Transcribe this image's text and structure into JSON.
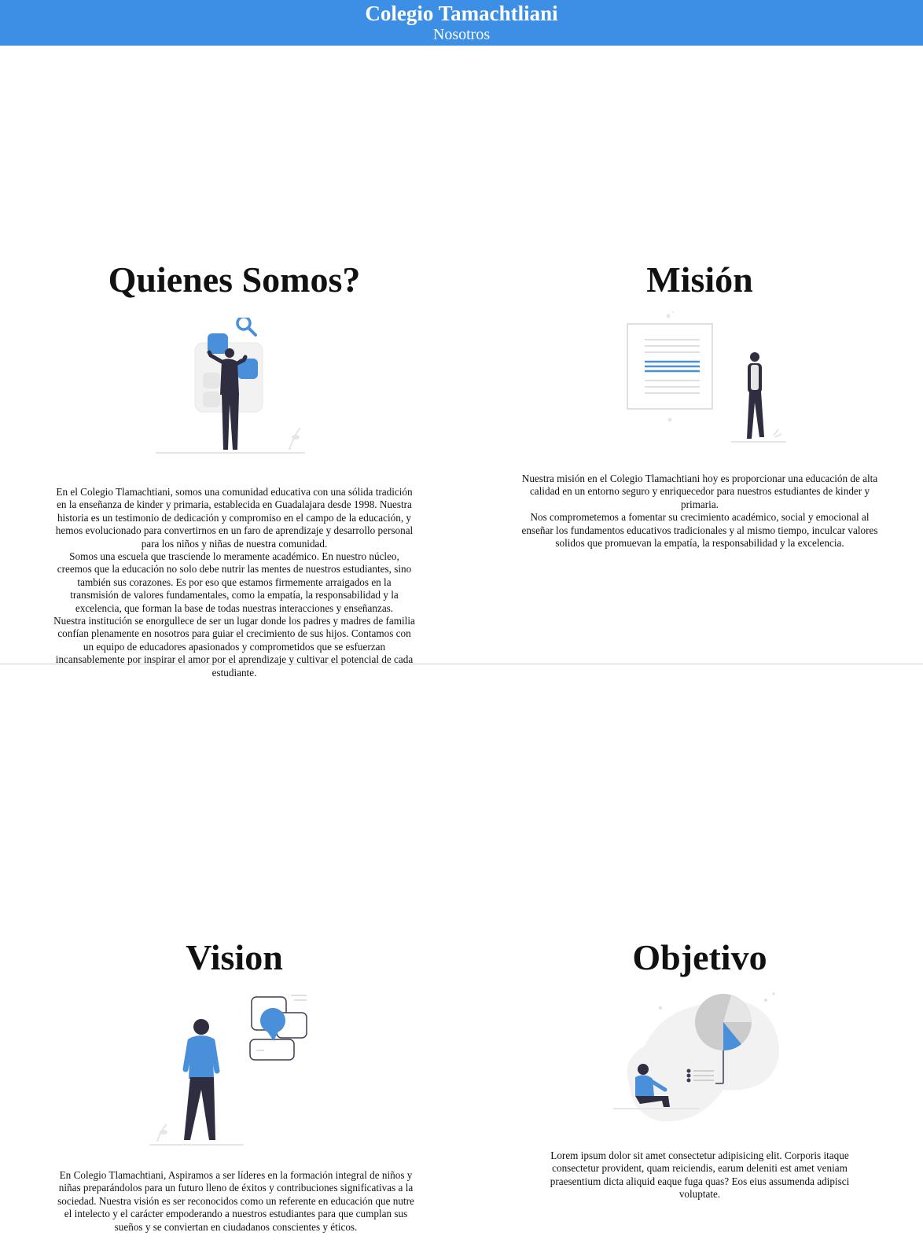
{
  "header": {
    "title": "Colegio Tamachtliani",
    "subtitle": "Nosotros",
    "background_color": "#3d8fe6"
  },
  "colors": {
    "accent": "#4a8fd9",
    "figure_dark": "#2f2e41",
    "ink": "#111111"
  },
  "sections": {
    "quienes": {
      "heading": "Quienes Somos?",
      "illustration_icon": "person-search-illustration",
      "paragraphs": [
        "En el Colegio Tlamachtiani, somos una comunidad educativa con una sólida tradición en la enseñanza de kinder y primaria, establecida en Guadalajara desde 1998. Nuestra historia es un testimonio de dedicación y compromiso en el campo de la educación, y hemos evolucionado para convertirnos en un faro de aprendizaje y desarrollo personal para los niños y niñas de nuestra comunidad.",
        "Somos una escuela que trasciende lo meramente académico. En nuestro núcleo, creemos que la educación no solo debe nutrir las mentes de nuestros estudiantes, sino también sus corazones. Es por eso que estamos firmemente arraigados en la transmisión de valores fundamentales, como la empatía, la responsabilidad y la excelencia, que forman la base de todas nuestras interacciones y enseñanzas.",
        "Nuestra institución se enorgullece de ser un lugar donde los padres y madres de familia confían plenamente en nosotros para guiar el crecimiento de sus hijos. Contamos con un equipo de educadores apasionados y comprometidos que se esfuerzan incansablemente por inspirar el amor por el aprendizaje y cultivar el potencial de cada estudiante."
      ]
    },
    "mision": {
      "heading": "Misión",
      "illustration_icon": "person-document-illustration",
      "paragraphs": [
        "Nuestra misión en el Colegio Tlamachtiani hoy es proporcionar una educación de alta calidad en un entorno seguro y enriquecedor para nuestros estudiantes de kinder y primaria.",
        "Nos comprometemos a fomentar su crecimiento académico, social y emocional al enseñar los fundamentos educativos tradicionales y al mismo tiempo, inculcar valores solidos que promuevan la empatía, la responsabilidad y la excelencia."
      ]
    },
    "vision": {
      "heading": "Vision",
      "illustration_icon": "person-ideas-illustration",
      "paragraphs": [
        "En Colegio Tlamachtiani, Aspiramos a ser líderes en la formación integral de niños y niñas preparándolos para un futuro lleno de éxitos y contribuciones significativas a la sociedad. Nuestra visión es ser reconocidos como un referente en educación que nutre el intelecto y el carácter empoderando a nuestros estudiantes para que cumplan sus sueños y se conviertan en ciudadanos conscientes y éticos."
      ]
    },
    "objetivo": {
      "heading": "Objetivo",
      "illustration_icon": "person-pie-chart-illustration",
      "paragraphs": [
        "Lorem ipsum dolor sit amet consectetur adipisicing elit. Corporis itaque consectetur provident, quam reiciendis, earum deleniti est amet veniam praesentium dicta aliquid eaque fuga quas? Eos eius assumenda adipisci voluptate."
      ]
    }
  }
}
